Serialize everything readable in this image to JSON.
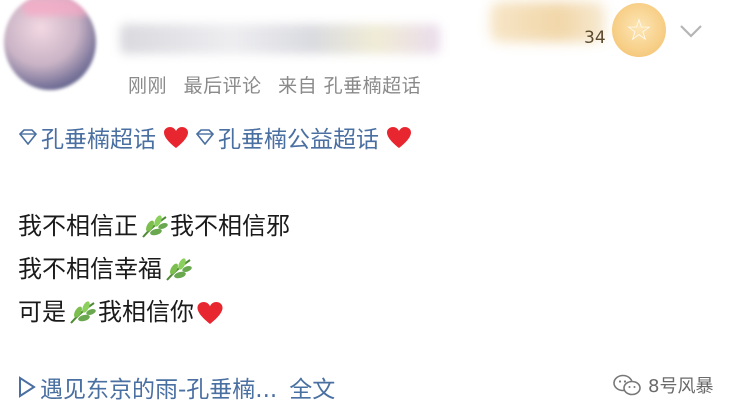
{
  "header": {
    "level_number": "34",
    "meta": {
      "time": "刚刚",
      "status": "最后评论",
      "source": "来自 孔垂楠超话"
    }
  },
  "topics": [
    {
      "label": "孔垂楠超话"
    },
    {
      "label": "孔垂楠公益超话"
    }
  ],
  "post": {
    "line1_part1": "我不相信正",
    "line1_part2": "我不相信邪",
    "line2": "我不相信幸福",
    "line3_part1": "可是",
    "line3_part2": "我相信你"
  },
  "footer": {
    "song": "遇见东京的雨-孔垂楠...",
    "full_text": "全文"
  },
  "watermark": {
    "text": "8号风暴"
  },
  "colors": {
    "link_blue": "#4a6fa1",
    "meta_gray": "#8a8a8a",
    "heart_red": "#e8262f",
    "leaf_green": "#6aa84f"
  }
}
